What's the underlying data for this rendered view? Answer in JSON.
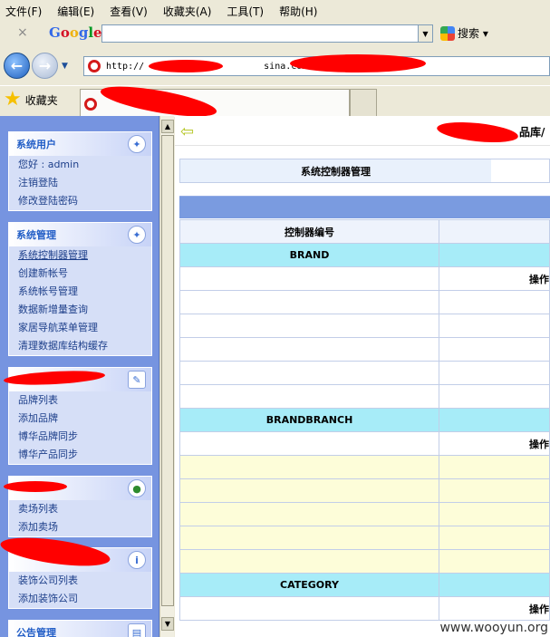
{
  "menu": [
    "文件(F)",
    "编辑(E)",
    "查看(V)",
    "收藏夹(A)",
    "工具(T)",
    "帮助(H)"
  ],
  "google_toolbar": {
    "close": "×",
    "logo": "Google",
    "search_label": "搜索 ▾"
  },
  "address": {
    "url_prefix": "http://",
    "url_domain": "sina.com.cn/"
  },
  "favorites": {
    "label": "收藏夹"
  },
  "sidebar": {
    "panels": [
      {
        "title": "系统用户",
        "items": [
          "您好 : admin",
          "注销登陆",
          "修改登陆密码"
        ]
      },
      {
        "title": "系统管理",
        "items": [
          "系统控制器管理",
          "创建新帐号",
          "系统帐号管理",
          "数据新增量查询",
          "家居导航菜单管理",
          "清理数据库结构缓存"
        ]
      },
      {
        "title": "",
        "items": [
          "品牌列表",
          "添加品牌",
          "博华品牌同步",
          "博华产品同步"
        ]
      },
      {
        "title": "",
        "items": [
          "卖场列表",
          "添加卖场"
        ]
      },
      {
        "title": "",
        "items": [
          "装饰公司列表",
          "添加装饰公司"
        ]
      },
      {
        "title": "公告管理",
        "items": []
      }
    ]
  },
  "main": {
    "top_right_text": "品库/",
    "page_title": "系统控制器管理",
    "table": {
      "header": "控制器编号",
      "op_label": "操作",
      "sections": [
        "BRAND",
        "BRANDBRANCH",
        "CATEGORY"
      ]
    }
  },
  "watermark": "www.wooyun.org"
}
